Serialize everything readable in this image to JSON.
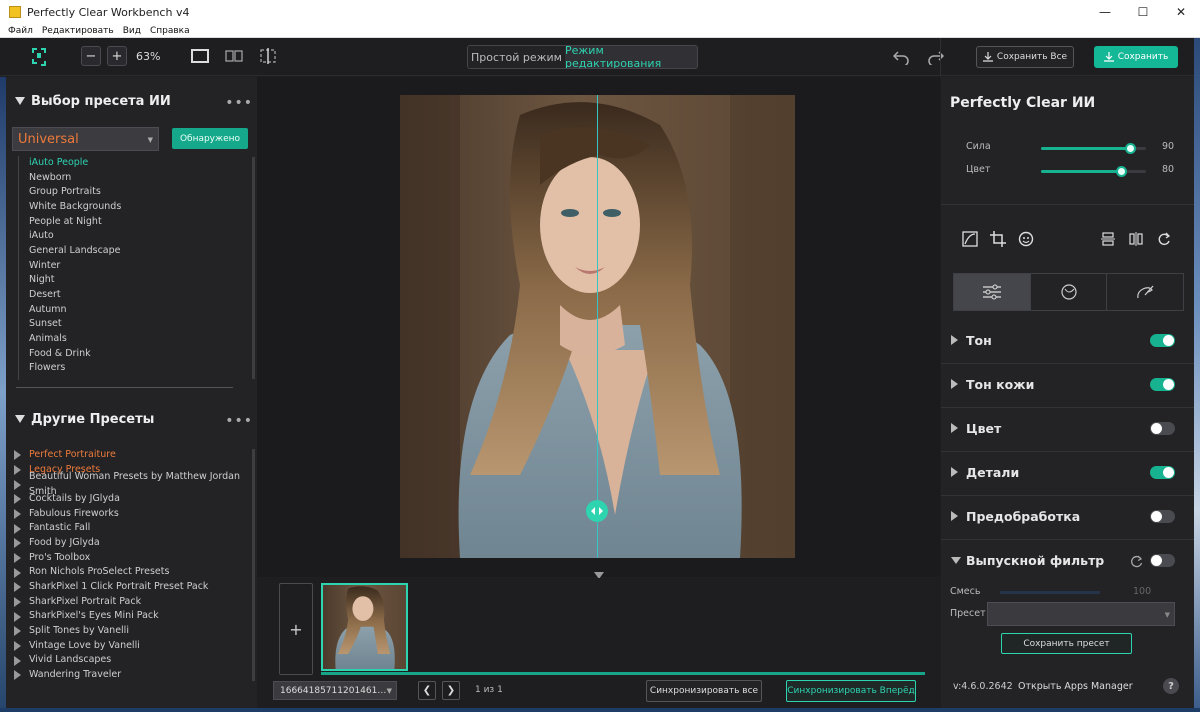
{
  "window": {
    "title": "Perfectly Clear Workbench v4",
    "controls": [
      "—",
      "☐",
      "✕"
    ]
  },
  "menu": [
    "Файл",
    "Редактировать",
    "Вид",
    "Справка"
  ],
  "toolbar": {
    "zoom_minus": "−",
    "zoom_plus": "+",
    "zoom_value": "63%",
    "mode_simple": "Простой режим",
    "mode_edit": "Режим редактирования",
    "save_all": "Сохранить Все",
    "save": "Сохранить",
    "accent": "#2ed3b0"
  },
  "ai_presets": {
    "title": "Выбор пресета ИИ",
    "selected": "Universal",
    "detected_label": "Обнаружено",
    "items": [
      "iAuto People",
      "Newborn",
      "Group Portraits",
      "White Backgrounds",
      "People at Night",
      "iAuto",
      "General Landscape",
      "Winter",
      "Night",
      "Desert",
      "Autumn",
      "Sunset",
      "Animals",
      "Food & Drink",
      "Flowers"
    ],
    "active_index": 0
  },
  "other_presets": {
    "title": "Другие Пресеты",
    "items": [
      {
        "label": "Perfect Portraiture",
        "highlight": true
      },
      {
        "label": "Legacy Presets",
        "highlight": true
      },
      {
        "label": "Beautiful Woman Presets by Matthew Jordan Smith",
        "highlight": false
      },
      {
        "label": "Cocktails by JGlyda",
        "highlight": false
      },
      {
        "label": "Fabulous Fireworks",
        "highlight": false
      },
      {
        "label": "Fantastic Fall",
        "highlight": false
      },
      {
        "label": "Food by JGlyda",
        "highlight": false
      },
      {
        "label": "Pro's Toolbox",
        "highlight": false
      },
      {
        "label": "Ron Nichols ProSelect Presets",
        "highlight": false
      },
      {
        "label": "SharkPixel 1 Click Portrait Preset Pack",
        "highlight": false
      },
      {
        "label": "SharkPixel Portrait Pack",
        "highlight": false
      },
      {
        "label": "SharkPixel's Eyes Mini Pack",
        "highlight": false
      },
      {
        "label": "Split Tones by Vanelli",
        "highlight": false
      },
      {
        "label": "Vintage Love by Vanelli",
        "highlight": false
      },
      {
        "label": "Vivid Landscapes",
        "highlight": false
      },
      {
        "label": "Wandering Traveler",
        "highlight": false
      }
    ]
  },
  "filmstrip": {
    "add_label": "+",
    "file_name": "16664185711201461…",
    "prev": "❮",
    "next": "❯",
    "page_count": "1 из 1",
    "sync_all": "Синхронизировать все",
    "sync_forward": "Синхронизировать Вперёд"
  },
  "right": {
    "title": "Perfectly Clear ИИ",
    "sliders": [
      {
        "label": "Сила",
        "value": 90,
        "fraction": 0.85
      },
      {
        "label": "Цвет",
        "value": 80,
        "fraction": 0.76
      }
    ],
    "sections": [
      {
        "label": "Тон",
        "on": true
      },
      {
        "label": "Тон кожи",
        "on": true
      },
      {
        "label": "Цвет",
        "on": false
      },
      {
        "label": "Детали",
        "on": true
      },
      {
        "label": "Предобработка",
        "on": false
      },
      {
        "label": "Выпускной фильтр",
        "on": false
      }
    ],
    "blend_label": "Смесь",
    "blend_value": "100",
    "preset_label": "Пресет",
    "save_preset": "Сохранить пресет",
    "version": "v:4.6.0.2642",
    "apps_manager": "Открыть Apps Manager",
    "help": "?"
  }
}
